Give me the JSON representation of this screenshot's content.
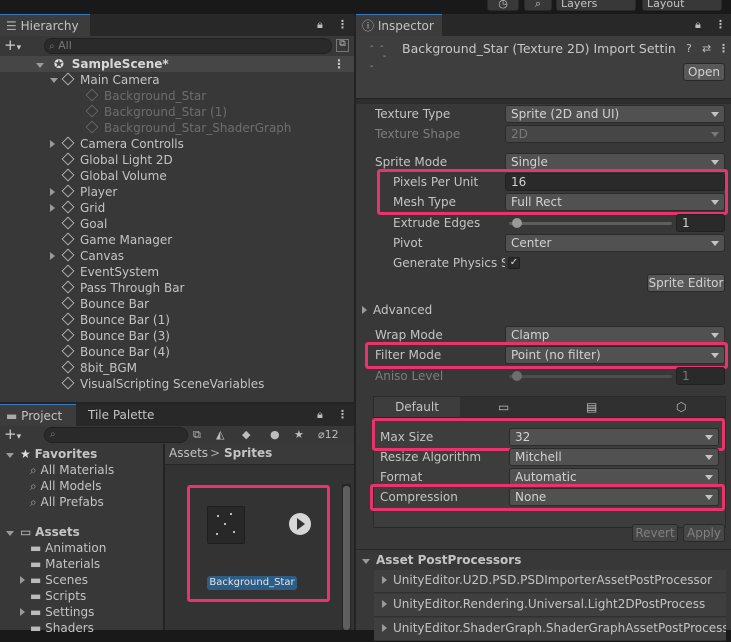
{
  "toolbar": {
    "history_icon": "history-icon",
    "search_icon": "search-icon",
    "layers_label": "Layers",
    "layout_label": "Layout"
  },
  "hierarchy": {
    "tab_label": "Hierarchy",
    "search_placeholder": "All",
    "scene_name": "SampleScene*",
    "items": [
      {
        "label": "Main Camera",
        "depth": 1,
        "fold": "open",
        "dim": false
      },
      {
        "label": "Background_Star",
        "depth": 2,
        "fold": "none",
        "dim": true
      },
      {
        "label": "Background_Star (1)",
        "depth": 2,
        "fold": "none",
        "dim": true
      },
      {
        "label": "Background_Star_ShaderGraph",
        "depth": 2,
        "fold": "none",
        "dim": true
      },
      {
        "label": "Camera Controlls",
        "depth": 1,
        "fold": "closed",
        "dim": false
      },
      {
        "label": "Global Light 2D",
        "depth": 1,
        "fold": "none",
        "dim": false
      },
      {
        "label": "Global Volume",
        "depth": 1,
        "fold": "none",
        "dim": false
      },
      {
        "label": "Player",
        "depth": 1,
        "fold": "closed",
        "dim": false
      },
      {
        "label": "Grid",
        "depth": 1,
        "fold": "closed",
        "dim": false
      },
      {
        "label": "Goal",
        "depth": 1,
        "fold": "none",
        "dim": false
      },
      {
        "label": "Game Manager",
        "depth": 1,
        "fold": "none",
        "dim": false
      },
      {
        "label": "Canvas",
        "depth": 1,
        "fold": "closed",
        "dim": false
      },
      {
        "label": "EventSystem",
        "depth": 1,
        "fold": "none",
        "dim": false
      },
      {
        "label": "Pass Through Bar",
        "depth": 1,
        "fold": "none",
        "dim": false
      },
      {
        "label": "Bounce Bar",
        "depth": 1,
        "fold": "none",
        "dim": false
      },
      {
        "label": "Bounce Bar (1)",
        "depth": 1,
        "fold": "none",
        "dim": false
      },
      {
        "label": "Bounce Bar (3)",
        "depth": 1,
        "fold": "none",
        "dim": false
      },
      {
        "label": "Bounce Bar (4)",
        "depth": 1,
        "fold": "none",
        "dim": false
      },
      {
        "label": "8bit_BGM",
        "depth": 1,
        "fold": "none",
        "dim": false
      },
      {
        "label": "VisualScripting SceneVariables",
        "depth": 1,
        "fold": "none",
        "dim": false
      }
    ]
  },
  "project": {
    "tab_project": "Project",
    "tab_tile_palette": "Tile Palette",
    "hidden_count": "12",
    "favorites_label": "Favorites",
    "favorites": [
      "All Materials",
      "All Models",
      "All Prefabs"
    ],
    "assets_label": "Assets",
    "folders": [
      {
        "label": "Animation",
        "fold": "none"
      },
      {
        "label": "Materials",
        "fold": "none"
      },
      {
        "label": "Scenes",
        "fold": "closed"
      },
      {
        "label": "Scripts",
        "fold": "none"
      },
      {
        "label": "Settings",
        "fold": "closed"
      },
      {
        "label": "Shaders",
        "fold": "none"
      }
    ],
    "breadcrumb_root": "Assets",
    "breadcrumb_sep": ">",
    "breadcrumb_current": "Sprites",
    "asset_name": "Background_Star"
  },
  "inspector": {
    "tab_label": "Inspector",
    "title": "Background_Star (Texture 2D) Import Settin",
    "open_button": "Open",
    "texture_type_label": "Texture Type",
    "texture_type_value": "Sprite (2D and UI)",
    "texture_shape_label": "Texture Shape",
    "texture_shape_value": "2D",
    "sprite_mode_label": "Sprite Mode",
    "sprite_mode_value": "Single",
    "ppu_label": "Pixels Per Unit",
    "ppu_value": "16",
    "mesh_type_label": "Mesh Type",
    "mesh_type_value": "Full Rect",
    "extrude_label": "Extrude Edges",
    "extrude_value": "1",
    "pivot_label": "Pivot",
    "pivot_value": "Center",
    "physics_label": "Generate Physics Sh",
    "sprite_editor_button": "Sprite Editor",
    "advanced_label": "Advanced",
    "wrap_label": "Wrap Mode",
    "wrap_value": "Clamp",
    "filter_label": "Filter Mode",
    "filter_value": "Point (no filter)",
    "aniso_label": "Aniso Level",
    "aniso_value": "1",
    "platform_tab_default": "Default",
    "max_size_label": "Max Size",
    "max_size_value": "32",
    "resize_label": "Resize Algorithm",
    "resize_value": "Mitchell",
    "format_label": "Format",
    "format_value": "Automatic",
    "compression_label": "Compression",
    "compression_value": "None",
    "revert_button": "Revert",
    "apply_button": "Apply",
    "postprocessors_label": "Asset PostProcessors",
    "postprocessors": [
      "UnityEditor.U2D.PSD.PSDImporterAssetPostProcessor",
      "UnityEditor.Rendering.Universal.Light2DPostProcess",
      "UnityEditor.ShaderGraph.ShaderGraphAssetPostProcessor"
    ]
  },
  "colors": {
    "highlight": "#e8336d",
    "selection": "#2c5d87",
    "accent": "#3a79bb"
  }
}
